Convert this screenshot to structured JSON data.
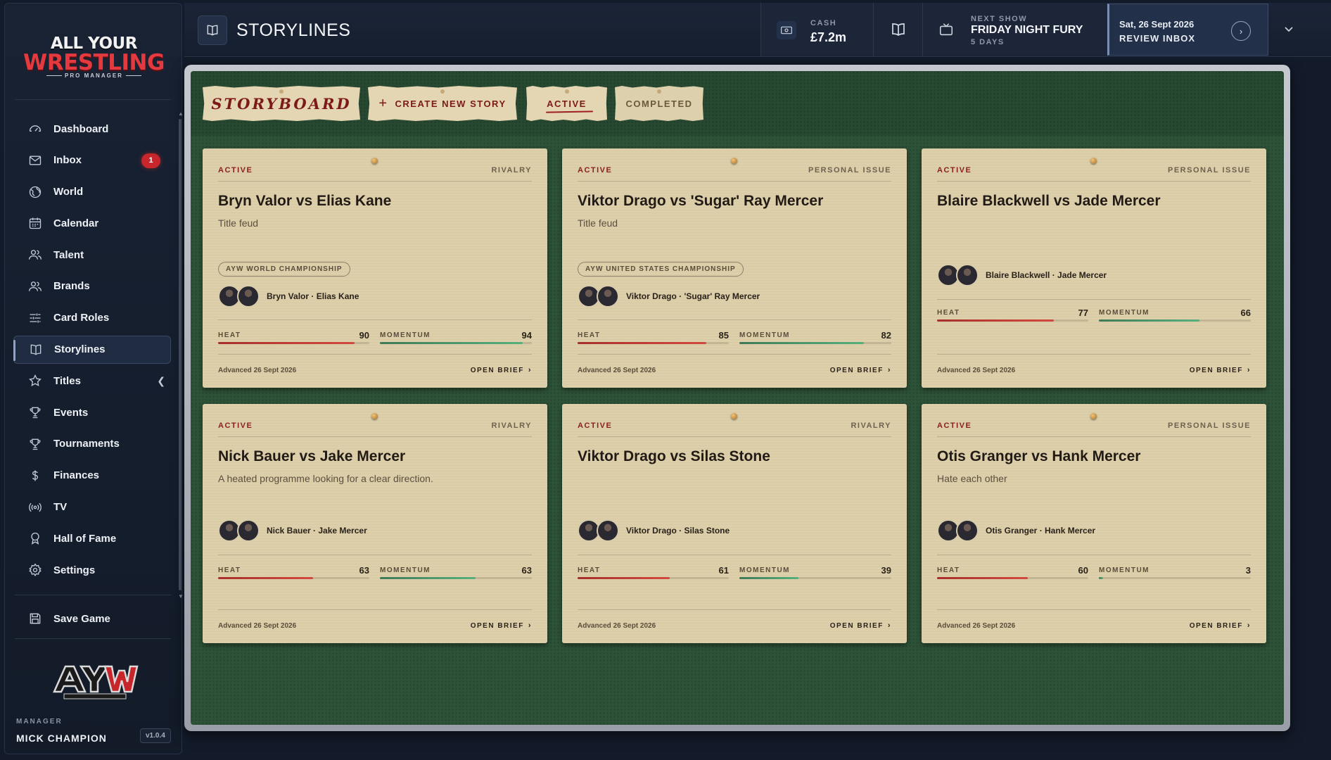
{
  "sidebar": {
    "logo": {
      "line1": "ALL YOUR",
      "line2": "WRESTLING",
      "line3": "PRO MANAGER"
    },
    "items": [
      {
        "label": "Dashboard",
        "icon": "gauge-icon"
      },
      {
        "label": "Inbox",
        "icon": "mail-icon",
        "badge": "1"
      },
      {
        "label": "World",
        "icon": "globe-icon"
      },
      {
        "label": "Calendar",
        "icon": "calendar-icon"
      },
      {
        "label": "Talent",
        "icon": "users-icon"
      },
      {
        "label": "Brands",
        "icon": "users-icon"
      },
      {
        "label": "Card Roles",
        "icon": "sliders-icon"
      },
      {
        "label": "Storylines",
        "icon": "book-icon",
        "active": true
      },
      {
        "label": "Titles",
        "icon": "star-icon"
      },
      {
        "label": "Events",
        "icon": "trophy-icon"
      },
      {
        "label": "Tournaments",
        "icon": "trophy-icon"
      },
      {
        "label": "Finances",
        "icon": "dollar-icon"
      },
      {
        "label": "TV",
        "icon": "broadcast-icon"
      },
      {
        "label": "Hall of Fame",
        "icon": "award-icon"
      },
      {
        "label": "Settings",
        "icon": "gear-icon"
      }
    ],
    "save": {
      "label": "Save Game",
      "icon": "save-icon"
    },
    "brand_mark": "AYW",
    "brand_mark_sub": "ALL YOUR WRESTLING",
    "manager_label": "MANAGER",
    "manager_name": "MICK CHAMPION",
    "version": "v1.0.4"
  },
  "topbar": {
    "title": "STORYLINES",
    "cash_label": "CASH",
    "cash_value": "£7.2m",
    "next_show_label": "NEXT SHOW",
    "next_show_name": "FRIDAY NIGHT FURY",
    "next_show_days": "5 DAYS",
    "date": "Sat, 26 Sept 2026",
    "action": "REVIEW INBOX"
  },
  "board": {
    "tabs": {
      "storyboard": "STORYBOARD",
      "create": "CREATE NEW STORY",
      "active": "ACTIVE",
      "completed": "COMPLETED"
    },
    "heat_label": "HEAT",
    "momentum_label": "MOMENTUM",
    "open_label": "OPEN BRIEF",
    "cards": [
      {
        "status": "ACTIVE",
        "kind": "RIVALRY",
        "title": "Bryn Valor vs Elias Kane",
        "subtitle": "Title feud",
        "championship": "AYW WORLD CHAMPIONSHIP",
        "names": "Bryn Valor · Elias Kane",
        "heat": 90,
        "momentum": 94,
        "advanced": "Advanced 26 Sept 2026"
      },
      {
        "status": "ACTIVE",
        "kind": "PERSONAL ISSUE",
        "title": "Viktor Drago vs 'Sugar' Ray Mercer",
        "subtitle": "Title feud",
        "championship": "AYW UNITED STATES CHAMPIONSHIP",
        "names": "Viktor Drago · 'Sugar' Ray Mercer",
        "heat": 85,
        "momentum": 82,
        "advanced": "Advanced 26 Sept 2026"
      },
      {
        "status": "ACTIVE",
        "kind": "PERSONAL ISSUE",
        "title": "Blaire Blackwell vs Jade Mercer",
        "subtitle": "",
        "championship": "",
        "names": "Blaire Blackwell · Jade Mercer",
        "heat": 77,
        "momentum": 66,
        "advanced": "Advanced 26 Sept 2026"
      },
      {
        "status": "ACTIVE",
        "kind": "RIVALRY",
        "title": "Nick Bauer vs Jake Mercer",
        "subtitle": "A heated programme looking for a clear direction.",
        "championship": "",
        "names": "Nick Bauer · Jake Mercer",
        "heat": 63,
        "momentum": 63,
        "advanced": "Advanced 26 Sept 2026"
      },
      {
        "status": "ACTIVE",
        "kind": "RIVALRY",
        "title": "Viktor Drago vs Silas Stone",
        "subtitle": "",
        "championship": "",
        "names": "Viktor Drago · Silas Stone",
        "heat": 61,
        "momentum": 39,
        "advanced": "Advanced 26 Sept 2026"
      },
      {
        "status": "ACTIVE",
        "kind": "PERSONAL ISSUE",
        "title": "Otis Granger vs Hank Mercer",
        "subtitle": "Hate each other",
        "championship": "",
        "names": "Otis Granger · Hank Mercer",
        "heat": 60,
        "momentum": 3,
        "advanced": "Advanced 26 Sept 2026"
      }
    ]
  },
  "colors": {
    "accent_red": "#8a1f1c",
    "heat": "#c9403a",
    "momentum": "#4f9e70",
    "board_green": "#2d5238",
    "paper": "#dccfaa"
  }
}
